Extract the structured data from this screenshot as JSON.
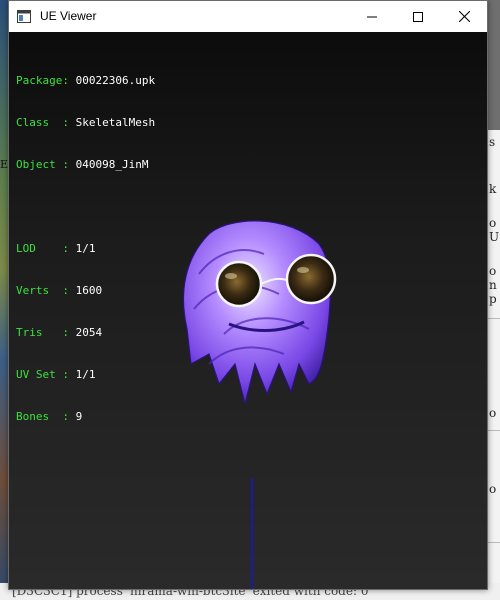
{
  "window": {
    "title": "UE Viewer"
  },
  "mesh_info": {
    "package": {
      "label": "Package: ",
      "value": "00022306.upk"
    },
    "class": {
      "label": "Class  : ",
      "value": "SkeletalMesh"
    },
    "object": {
      "label": "Object : ",
      "value": "040098_JinM"
    },
    "lod": {
      "label": "LOD    : ",
      "value": "1/1"
    },
    "verts": {
      "label": "Verts  : ",
      "value": "1600"
    },
    "tris": {
      "label": "Tris   : ",
      "value": "2054"
    },
    "uvset": {
      "label": "UV Set : ",
      "value": "1/1"
    },
    "bones": {
      "label": "Bones  : ",
      "value": "9"
    }
  },
  "background": {
    "console_chars": [
      "s",
      "k",
      "o",
      "U",
      "o",
      "n",
      "p",
      "o",
      "o",
      "o"
    ],
    "left_char": "E",
    "status_text": "[D3C3C1] process 'hirama-win-btc3ite' exited with code: 0"
  },
  "colors": {
    "label_green": "#3ee03e",
    "value_white": "#ffffff",
    "hair_purple": "#8a5cf0",
    "axis_blue": "#1a1aa8"
  }
}
